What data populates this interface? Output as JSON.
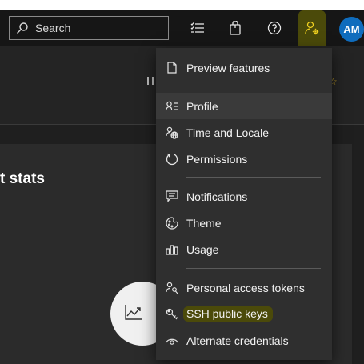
{
  "header": {
    "search_placeholder": "Search",
    "avatar_initials": "AM"
  },
  "main": {
    "card_title": "t stats"
  },
  "user_menu": {
    "items": [
      {
        "label": "Preview features",
        "icon": "page-icon"
      },
      {
        "label": "Profile",
        "icon": "profile-icon"
      },
      {
        "label": "Time and Locale",
        "icon": "time-locale-icon"
      },
      {
        "label": "Permissions",
        "icon": "permissions-icon"
      },
      {
        "label": "Notifications",
        "icon": "notifications-icon"
      },
      {
        "label": "Theme",
        "icon": "theme-icon"
      },
      {
        "label": "Usage",
        "icon": "usage-icon"
      },
      {
        "label": "Personal access tokens",
        "icon": "personal-access-tokens-icon"
      },
      {
        "label": "SSH public keys",
        "icon": "ssh-key-icon"
      },
      {
        "label": "Alternate credentials",
        "icon": "alternate-credentials-icon"
      }
    ]
  },
  "colors": {
    "highlight": "#4b4a0a",
    "avatar_bg": "#0f6cbd",
    "menu_bg": "#2f2f2f",
    "topbar_bg": "#161616"
  }
}
